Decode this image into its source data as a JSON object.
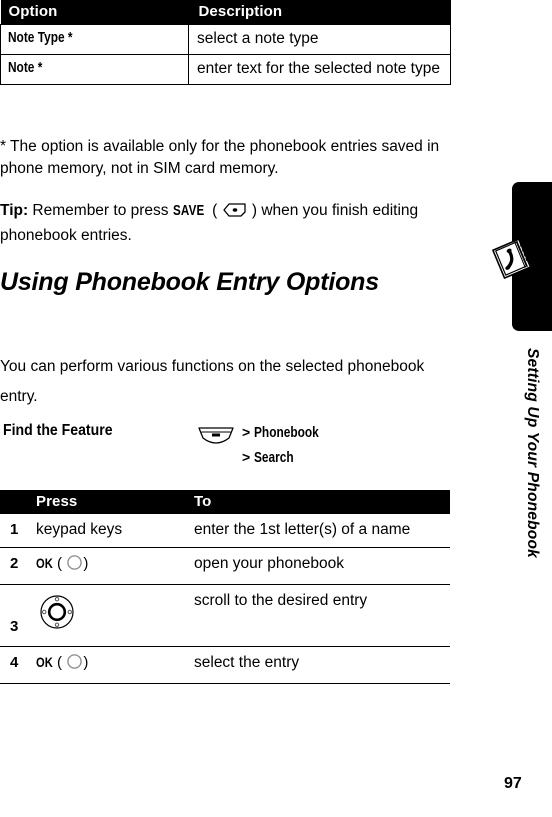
{
  "options_table": {
    "headers": [
      "Option",
      "Description"
    ],
    "rows": [
      {
        "option": "Note Type *",
        "description": "select a note type"
      },
      {
        "option": "Note *",
        "description": "enter text for the selected note type"
      }
    ]
  },
  "footnote": "* The option is available only for the phonebook entries saved in phone memory, not in SIM card memory.",
  "tip": {
    "label": "Tip:",
    "text_before": " Remember to press ",
    "key_label": "SAVE",
    "key_icon": "softkey-right-icon",
    "text_after": " ) when you finish editing phonebook entries.",
    "open_paren": "(",
    "close_paren": ")"
  },
  "section": {
    "heading": "Using Phonebook Entry Options",
    "intro": "You can perform various functions on the selected phonebook entry."
  },
  "find_the_feature": {
    "label": "Find the Feature",
    "key_icon": "menu-key-icon",
    "path": [
      {
        "separator": ">",
        "label": "Phonebook"
      },
      {
        "separator": ">",
        "label": "Search"
      }
    ]
  },
  "steps_table": {
    "headers": [
      "",
      "Press",
      "To"
    ],
    "rows": [
      {
        "num": "1",
        "press_text": "keypad keys",
        "press_key": "",
        "press_icon": "",
        "to": "enter the 1st letter(s) of a name"
      },
      {
        "num": "2",
        "press_text": "",
        "press_key": "OK",
        "press_icon": "ok-key-circle-icon",
        "to": "open your phonebook"
      },
      {
        "num": "3",
        "press_text": "",
        "press_key": "",
        "press_icon": "navigation-dpad-icon",
        "to": "scroll to the desired entry"
      },
      {
        "num": "4",
        "press_text": "",
        "press_key": "OK",
        "press_icon": "ok-key-circle-icon",
        "to": "select the entry"
      }
    ]
  },
  "sidebar": {
    "title": "Setting Up Your Phonebook",
    "icon": "phonebook-book-icon",
    "tab_color": "#000000"
  },
  "page_number": "97"
}
